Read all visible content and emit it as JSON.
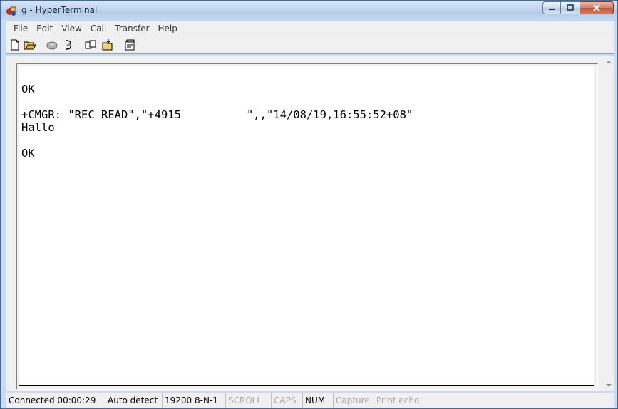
{
  "window": {
    "title": "g - HyperTerminal"
  },
  "menu": [
    "File",
    "Edit",
    "View",
    "Call",
    "Transfer",
    "Help"
  ],
  "toolbar": [
    "new-icon",
    "open-icon",
    "disconnect-icon",
    "dial-icon",
    "send-icon",
    "receive-icon",
    "properties-icon"
  ],
  "terminal": {
    "lines": [
      "OK",
      "",
      "+CMGR: \"REC READ\",\"+4915",
      "Hallo",
      "",
      "OK"
    ],
    "line3_tail": "\",,\"14/08/19,16:55:52+08\""
  },
  "status": {
    "connected": "Connected 00:00:29",
    "detect": "Auto detect",
    "port": "19200 8-N-1",
    "scroll": "SCROLL",
    "caps": "CAPS",
    "num": "NUM",
    "capture": "Capture",
    "print_echo": "Print echo"
  },
  "colors": {
    "titlebar": "#bcd3ee",
    "close_button": "#c4533a",
    "chrome": "#f0f0f0"
  }
}
